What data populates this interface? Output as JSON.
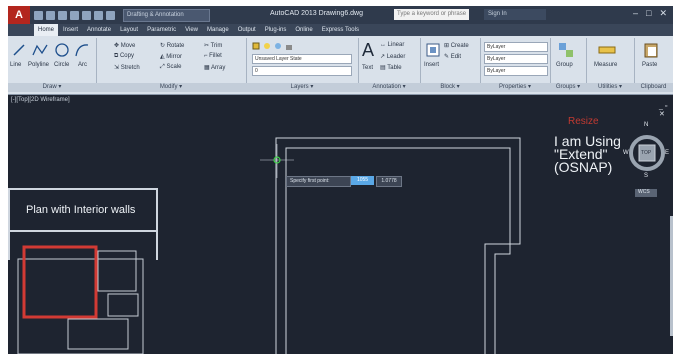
{
  "titlebar": {
    "app_letter": "A",
    "workspace": "Drafting & Annotation",
    "doc_title": "AutoCAD 2013  Drawing6.dwg",
    "search_placeholder": "Type a keyword or phrase",
    "signin": "Sign In",
    "controls": [
      "–",
      "□",
      "✕"
    ]
  },
  "tabs": [
    "Home",
    "Insert",
    "Annotate",
    "Layout",
    "Parametric",
    "View",
    "Manage",
    "Output",
    "Plug-ins",
    "Online",
    "Express Tools"
  ],
  "ribbon": {
    "draw": {
      "title": "Draw ▾",
      "line": "Line",
      "polyline": "Polyline",
      "circle": "Circle",
      "arc": "Arc"
    },
    "modify": {
      "title": "Modify ▾",
      "move": "Move",
      "rotate": "Rotate",
      "trim": "Trim",
      "copy": "Copy",
      "mirror": "Mirror",
      "fillet": "Fillet",
      "stretch": "Stretch",
      "scale": "Scale",
      "array": "Array"
    },
    "layers": {
      "title": "Layers ▾",
      "layer_state": "Unsaved Layer State",
      "current": "0"
    },
    "annotation": {
      "title": "Annotation ▾",
      "text": "Text",
      "linear": "Linear",
      "leader": "Leader",
      "table": "Table"
    },
    "block": {
      "title": "Block ▾",
      "insert": "Insert",
      "create": "Create",
      "edit": "Edit"
    },
    "properties": {
      "title": "Properties ▾",
      "bylayer1": "ByLayer",
      "bylayer2": "ByLayer",
      "bylayer3": "ByLayer"
    },
    "groups": {
      "title": "Groups ▾",
      "group": "Group"
    },
    "utilities": {
      "title": "Utilities ▾",
      "measure": "Measure"
    },
    "clipboard": {
      "title": "Clipboard",
      "paste": "Paste"
    }
  },
  "viewport": {
    "label": "[-][Top][2D Wireframe]",
    "inset_title": "Plan with Interior walls",
    "note_red": "Resize",
    "note_lines": [
      "I am Using",
      "\"Extend\"",
      "(OSNAP)"
    ],
    "command_prompt": "Specify first point:",
    "command_x": "1055",
    "command_y": "1.0778",
    "viewcube": {
      "n": "N",
      "e": "E",
      "s": "S",
      "w": "W",
      "face": "TOP",
      "wcs": "WCS"
    }
  }
}
